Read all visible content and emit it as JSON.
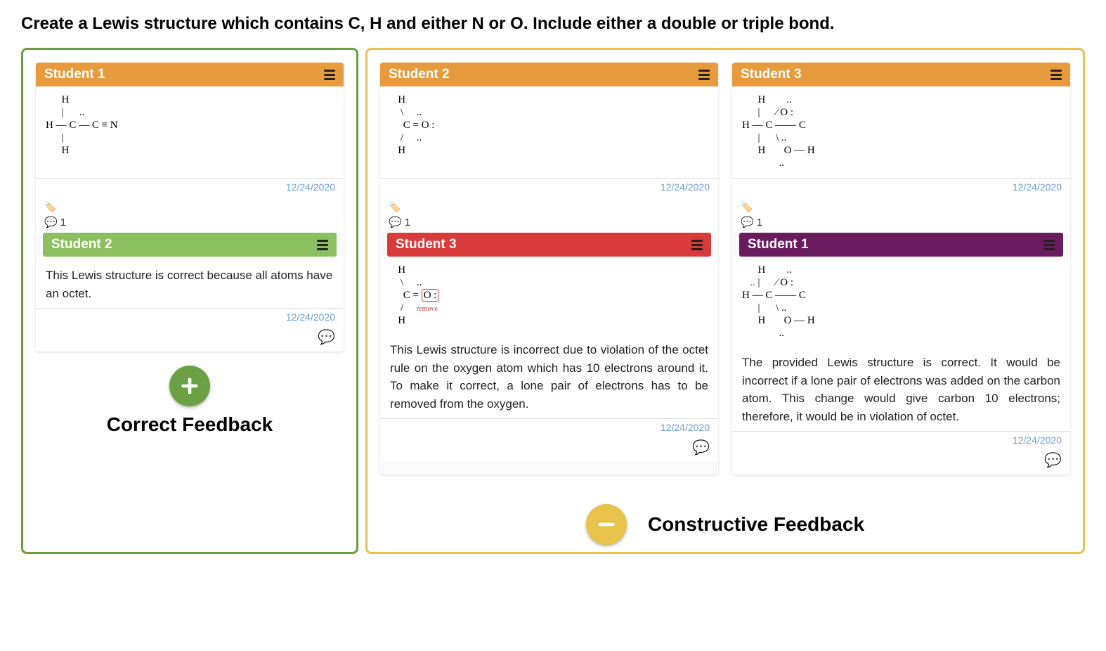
{
  "prompt": "Create a Lewis structure which contains C, H and either N or O. Include either a double or triple bond.",
  "sections": {
    "correct": {
      "label": "Correct Feedback"
    },
    "constructive": {
      "label": "Constructive Feedback"
    }
  },
  "cards": {
    "s1_post": {
      "header": "Student 1",
      "date": "12/24/2020",
      "structure_desc": "H-C(H3)-C≡N with lone pair on N",
      "comment_count": "1"
    },
    "s1_feedback": {
      "header": "Student 2",
      "text": "This Lewis structure is correct because all atoms have an octet.",
      "date": "12/24/2020"
    },
    "s2_post": {
      "header": "Student 2",
      "date": "12/24/2020",
      "structure_desc": "H2C=O with two lone pairs on O",
      "comment_count": "1"
    },
    "s2_feedback": {
      "header": "Student 3",
      "structure_desc": "H2C=O with oxygen lone pairs circled in red",
      "text": "This Lewis structure is incorrect due to violation of the octet rule on the oxygen atom which has 10 electrons around it. To make it correct, a lone pair of electrons has to be removed from the oxygen.",
      "date": "12/24/2020"
    },
    "s3_post": {
      "header": "Student 3",
      "date": "12/24/2020",
      "structure_desc": "H-C(H2)-C(=O)(O-H) carboxylic acid structure with lone pairs on O",
      "comment_count": "1"
    },
    "s3_feedback": {
      "header": "Student 1",
      "structure_desc": "Same carboxylic acid structure with red annotation near carbon",
      "text": "The provided Lewis structure is correct. It would be incorrect if a lone pair of electrons was added on the carbon atom. This change would give carbon 10 electrons; therefore, it would be in violation of octet.",
      "date": "12/24/2020"
    }
  }
}
